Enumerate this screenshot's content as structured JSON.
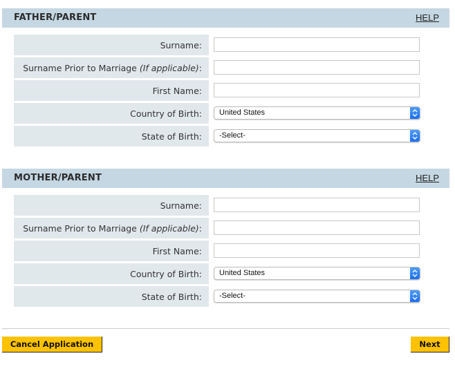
{
  "sections": [
    {
      "title": "FATHER/PARENT",
      "help_label": "HELP",
      "fields": [
        {
          "label": "Surname:",
          "type": "text",
          "value": ""
        },
        {
          "label_main": "Surname Prior to Marriage ",
          "label_italic": "(If applicable)",
          "label_suffix": ":",
          "type": "text",
          "value": ""
        },
        {
          "label": "First Name:",
          "type": "text",
          "value": ""
        },
        {
          "label": "Country of Birth:",
          "type": "select",
          "value": "United States"
        },
        {
          "label": "State of Birth:",
          "type": "select",
          "value": "-Select-"
        }
      ]
    },
    {
      "title": "MOTHER/PARENT",
      "help_label": "HELP",
      "fields": [
        {
          "label": "Surname:",
          "type": "text",
          "value": ""
        },
        {
          "label_main": "Surname Prior to Marriage ",
          "label_italic": "(If applicable)",
          "label_suffix": ":",
          "type": "text",
          "value": ""
        },
        {
          "label": "First Name:",
          "type": "text",
          "value": ""
        },
        {
          "label": "Country of Birth:",
          "type": "select",
          "value": "United States"
        },
        {
          "label": "State of Birth:",
          "type": "select",
          "value": "-Select-"
        }
      ]
    }
  ],
  "footer": {
    "cancel_label": "Cancel Application",
    "next_label": "Next"
  },
  "colors": {
    "section_header_bg": "#c5d7e2",
    "label_cell_bg": "#e1e8ec",
    "button_bg": "#ffc200",
    "select_arrow": "#1b6ff2"
  }
}
